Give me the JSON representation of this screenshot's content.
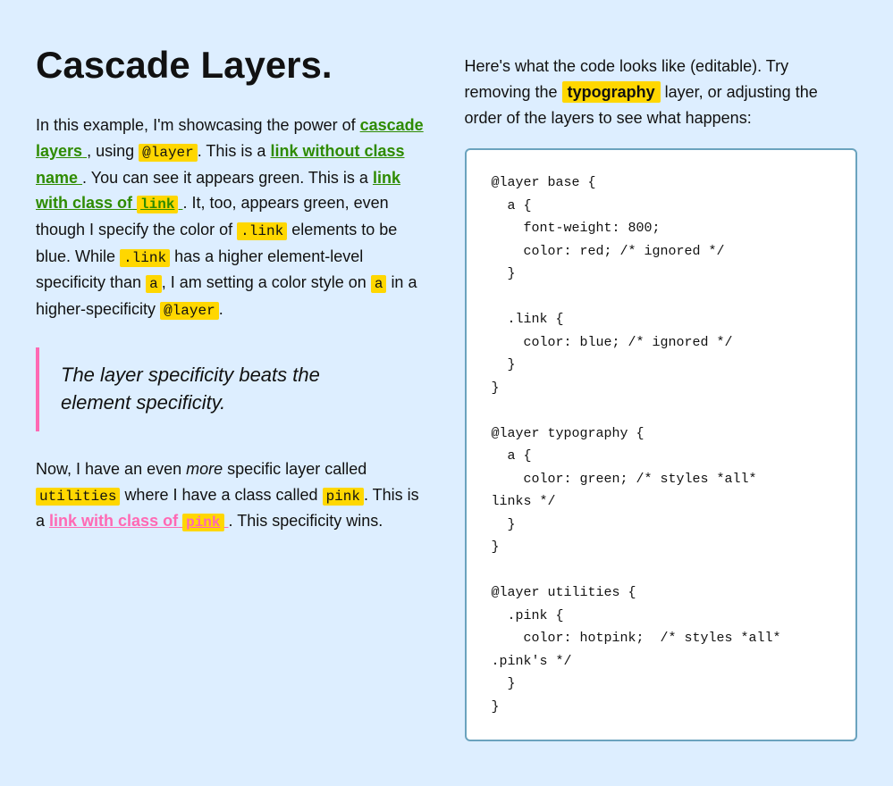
{
  "page": {
    "background": "#ddeeff"
  },
  "left": {
    "title": "Cascade Layers.",
    "intro": "In this example, I'm showcasing the power of",
    "cascade_layers_link": "cascade layers",
    "using_text": ", using",
    "at_layer_code": "@layer",
    "this_is_a": ". This is a",
    "link_no_class": "link without class name",
    "link_no_class_after": ". You can see it appears green. This is a",
    "link_with_class_text": "link with class of",
    "link_code": "link",
    "link_after": ". It, too, appears green, even though I specify the color of",
    "dot_link_1": ".link",
    "elements_blue": "elements to be blue. While",
    "dot_link_2": ".link",
    "higher_spec": "has a higher element-level specificity than",
    "a_code": "a",
    "i_am": ", I am setting a color style on",
    "a_code2": "a",
    "in_higher": "in a higher-specificity",
    "at_layer_code2": "@layer",
    "period": ".",
    "blockquote_line1": "The",
    "blockquote_layer": "layer",
    "blockquote_mid": "specificity beats the",
    "blockquote_line2": "element specificity",
    "blockquote_period": ".",
    "now_text": "Now, I have an even",
    "more_em": "more",
    "specific_text": "specific layer called",
    "utilities_code": "utilities",
    "where_class": "where I have a class called",
    "pink_code": "pink",
    "this_is_a2": ". This is a",
    "link_with_class_pink_text": "link with class of",
    "pink_highlight": "pink",
    "this_specificity": ". This specificity wins."
  },
  "right": {
    "desc_1": "Here's what the code looks like (editable). Try removing the",
    "typography_highlight": "typography",
    "desc_2": "layer, or adjusting the order of the layers to see what happens:",
    "code": "@layer base {\n  a {\n    font-weight: 800;\n    color: red; /* ignored */\n  }\n\n  .link {\n    color: blue; /* ignored */\n  }\n}\n\n@layer typography {\n  a {\n    color: green; /* styles *all*\nlinks */\n  }\n}\n\n@layer utilities {\n  .pink {\n    color: hotpink;  /* styles *all*\n.pink's */\n  }\n}"
  }
}
